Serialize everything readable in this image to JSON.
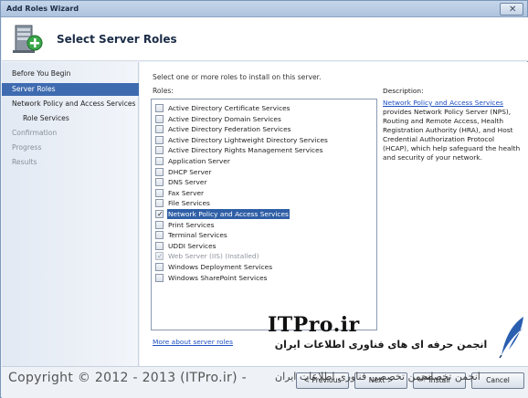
{
  "window": {
    "title": "Add Roles Wizard"
  },
  "header": {
    "heading": "Select Server Roles"
  },
  "nav": {
    "items": [
      {
        "label": "Before You Begin"
      },
      {
        "label": "Server Roles"
      },
      {
        "label": "Network Policy and Access Services"
      },
      {
        "label": "Role Services"
      },
      {
        "label": "Confirmation"
      },
      {
        "label": "Progress"
      },
      {
        "label": "Results"
      }
    ]
  },
  "content": {
    "instruction": "Select one or more roles to install on this server.",
    "roles_label": "Roles:",
    "roles": [
      {
        "label": "Active Directory Certificate Services"
      },
      {
        "label": "Active Directory Domain Services"
      },
      {
        "label": "Active Directory Federation Services"
      },
      {
        "label": "Active Directory Lightweight Directory Services"
      },
      {
        "label": "Active Directory Rights Management Services"
      },
      {
        "label": "Application Server"
      },
      {
        "label": "DHCP Server"
      },
      {
        "label": "DNS Server"
      },
      {
        "label": "Fax Server"
      },
      {
        "label": "File Services"
      },
      {
        "label": "Network Policy and Access Services"
      },
      {
        "label": "Print Services"
      },
      {
        "label": "Terminal Services"
      },
      {
        "label": "UDDI Services"
      },
      {
        "label": "Web Server (IIS)  (Installed)"
      },
      {
        "label": "Windows Deployment Services"
      },
      {
        "label": "Windows SharePoint Services"
      }
    ],
    "more_link": "More about server roles"
  },
  "description": {
    "heading": "Description:",
    "link": "Network Policy and Access Services",
    "text": "provides Network Policy Server (NPS), Routing and Remote Access, Health Registration Authority (HRA), and Host Credential Authorization Protocol (HCAP), which help safeguard the health and security of your network."
  },
  "logo": {
    "brand": "ITPro.ir",
    "tagline": "انجمن حرفه ای های فناوری اطلاعات ایران"
  },
  "footer": {
    "prev": "< Previous",
    "next": "Next >",
    "install": "Install",
    "cancel": "Cancel"
  },
  "watermark": {
    "copyright": "Copyright © 2012 - 2013 (ITPro.ir) -",
    "fa_a": "انجمن تخصصی فناوری اطلاعات ایران",
    "fa_b": "انجمن تخصصی"
  }
}
